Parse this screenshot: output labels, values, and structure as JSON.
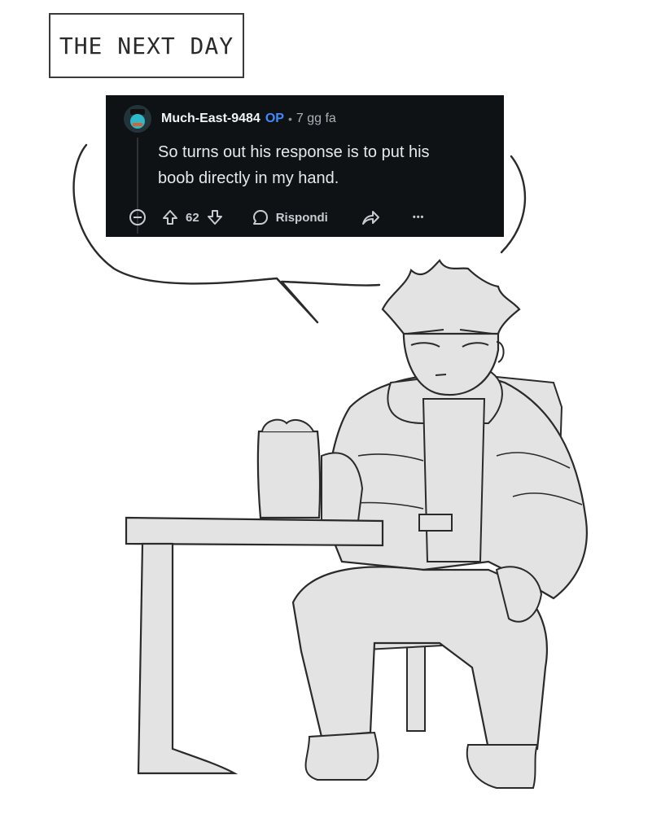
{
  "caption": {
    "text": "THE NEXT DAY"
  },
  "comment": {
    "author": "Much-East-9484",
    "badge": "OP",
    "separator": "•",
    "time": "7 gg fa",
    "body_line1": "So turns out his response is to put his",
    "body_line2": "boob directly in my hand.",
    "vote_count": "62",
    "reply_label": "Rispondi",
    "more_label": "•••"
  },
  "colors": {
    "card_bg": "#0f1214",
    "op_badge": "#3d8bff",
    "sketch_fill": "#e3e3e3",
    "ink": "#2a2a2a"
  },
  "icons": [
    "collapse-icon",
    "upvote-icon",
    "downvote-icon",
    "reply-bubble-icon",
    "share-icon",
    "more-options-icon"
  ]
}
